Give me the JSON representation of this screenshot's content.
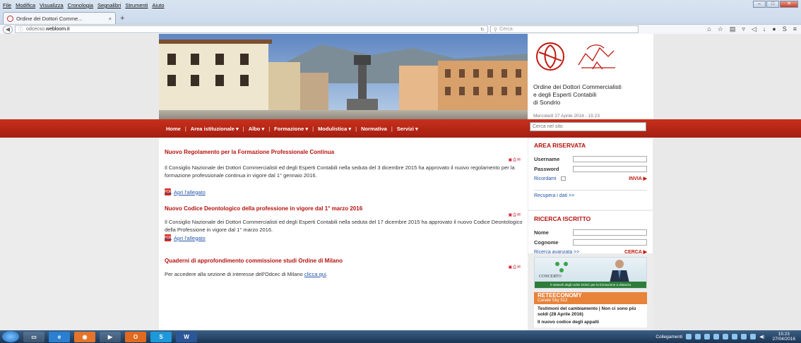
{
  "browser": {
    "menu": [
      "File",
      "Modifica",
      "Visualizza",
      "Cronologia",
      "Segnalibri",
      "Strumenti",
      "Aiuto"
    ],
    "tab_title": "Ordine dei Dottori Comme...",
    "tab_close": "×",
    "new_tab": "+",
    "url_prefix": "odcecso.",
    "url_domain": "webloom.it",
    "search_placeholder": "Cerca",
    "window_controls": [
      "–",
      "□",
      "✕"
    ]
  },
  "site": {
    "org_name_line1": "Ordine dei Dottori Commercialisti",
    "org_name_line2": "e degli Esperti Contabili",
    "org_name_line3": "di Sondrio",
    "date": "Mercoledì 27 Aprile 2016 - 15:23",
    "search_placeholder": "Cerca nel sito"
  },
  "nav": {
    "items": [
      "Home",
      "Area istituzionale ▾",
      "Albo ▾",
      "Formazione ▾",
      "Modulistica ▾",
      "Normativa",
      "Servizi ▾"
    ]
  },
  "articles": [
    {
      "title": "Nuovo Regolamento per la Formazione Professionale Continua",
      "body": "Il Consiglio Nazionale dei Dottori Commercialisti ed degli Esperti Contabili nella seduta del 3 dicembre 2015 ha approvato il nuovo regolamento per la formazione professionale continua in vigore dal 1° gennaio 2016.",
      "attachment": "Apri l'allegato"
    },
    {
      "title": "Nuovo Codice Deontologico della professione in vigore dal 1° marzo 2016",
      "body": "Il Consiglio Nazionale dei Dottori Commercialisti ed degli Esperti Contabili nella seduta del 17 dicembre 2015 ha approvato il nuovo Codice Deontologico della Professione in vigore dal 1° marzo 2016.",
      "attachment": "Apri l'allegato"
    },
    {
      "title": "Quaderni di approfondimento commissione studi Ordine di Milano",
      "body_prefix": "Per accedere alla sezione di interesse dell'Odcec di Milano ",
      "body_link": "clicca qui",
      "body_suffix": "."
    }
  ],
  "area_riservata": {
    "title": "AREA RISERVATA",
    "username_label": "Username",
    "password_label": "Password",
    "remember_label": "Ricordami",
    "submit": "INVIA ▶",
    "recover": "Recupera i dati >>"
  },
  "ricerca": {
    "title": "RICERCA ISCRITTO",
    "nome_label": "Nome",
    "cognome_label": "Cognome",
    "advanced": "Ricerca avanzata >>",
    "submit": "CERCA ▶"
  },
  "concerto": {
    "label": "CONCERTO",
    "footer": "Il network degli ordini DCEC per la formazione a distanza"
  },
  "news": {
    "brand": "RETEECONOMY",
    "channel": "Canale Sky 512",
    "item1": "Testimoni del cambiamento | Non ci sono più soldi (28 Aprile 2016)",
    "item2": "Il nuovo codice degli appalti"
  },
  "taskbar": {
    "links_label": "Collegamenti",
    "time": "15:23",
    "date": "27/04/2016"
  },
  "colors": {
    "accent_red": "#b5120e",
    "nav_band": "#b8271a",
    "link_blue": "#2255aa",
    "news_orange": "#e8833a"
  }
}
